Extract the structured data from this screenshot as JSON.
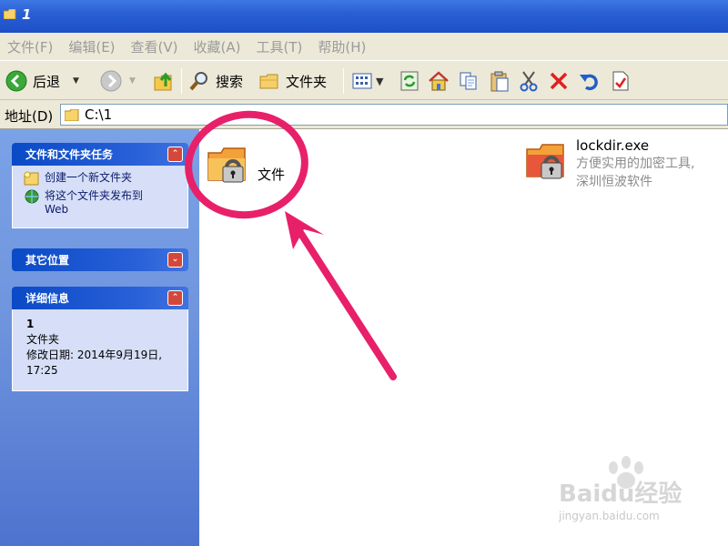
{
  "window": {
    "title": "1"
  },
  "menu": [
    "文件(F)",
    "编辑(E)",
    "查看(V)",
    "收藏(A)",
    "工具(T)",
    "帮助(H)"
  ],
  "toolbar": {
    "back_label": "后退",
    "search_label": "搜索",
    "folders_label": "文件夹"
  },
  "address": {
    "label": "地址(D)",
    "path": "C:\\1"
  },
  "tasks": {
    "title": "文件和文件夹任务",
    "items": [
      "创建一个新文件夹",
      "将这个文件夹发布到",
      "Web"
    ]
  },
  "other_places": {
    "title": "其它位置"
  },
  "details": {
    "title": "详细信息",
    "name": "1",
    "type": "文件夹",
    "modified_line1": "修改日期: 2014年9月19日,",
    "modified_line2": "17:25"
  },
  "files": [
    {
      "name": "文件"
    },
    {
      "name": "lockdir.exe",
      "desc1": "方便实用的加密工具,",
      "desc2": "深圳恒波软件"
    }
  ],
  "watermark": {
    "brand": "Baidu经验",
    "url": "jingyan.baidu.com"
  },
  "colors": {
    "titlebar": "#2a5fd4",
    "taskpane": "#6f95de",
    "annotation": "#e8206a"
  }
}
